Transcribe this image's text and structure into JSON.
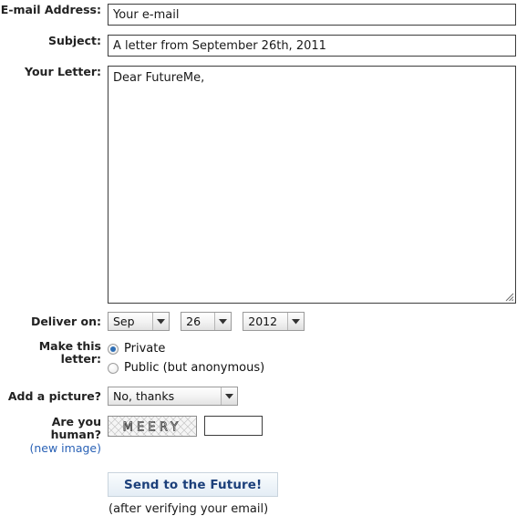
{
  "form": {
    "email": {
      "label": "E-mail Address:",
      "value": "Your e-mail",
      "placeholder": "Your e-mail"
    },
    "subject": {
      "label": "Subject:",
      "value": "A letter from September 26th, 2011",
      "placeholder": "Subject"
    },
    "letter": {
      "label": "Your Letter:",
      "value": "Dear FutureMe,",
      "placeholder": "Dear FutureMe,"
    },
    "deliver": {
      "label": "Deliver on:",
      "month": "Sep",
      "day": "26",
      "year": "2012"
    },
    "privacy": {
      "label": "Make this letter:",
      "options": [
        {
          "label": "Private",
          "selected": true
        },
        {
          "label": "Public (but anonymous)",
          "selected": false
        }
      ]
    },
    "picture": {
      "label": "Add a picture?",
      "value": "No, thanks"
    },
    "captcha": {
      "label": "Are you human?",
      "link": "(new image)",
      "image_text": "MEERY",
      "input_value": "",
      "input_placeholder": ""
    },
    "submit": {
      "label": "Send to the Future!",
      "note": "(after verifying your email)"
    }
  },
  "colors": {
    "label": "#222222",
    "link": "#2a62b6",
    "button_text": "#1b3f7a",
    "radio_dot": "#2f6fb5",
    "input_border": "#3d3d3d"
  },
  "icons": {
    "dropdown": "chevron-down-icon",
    "resize": "resize-grip-icon"
  }
}
